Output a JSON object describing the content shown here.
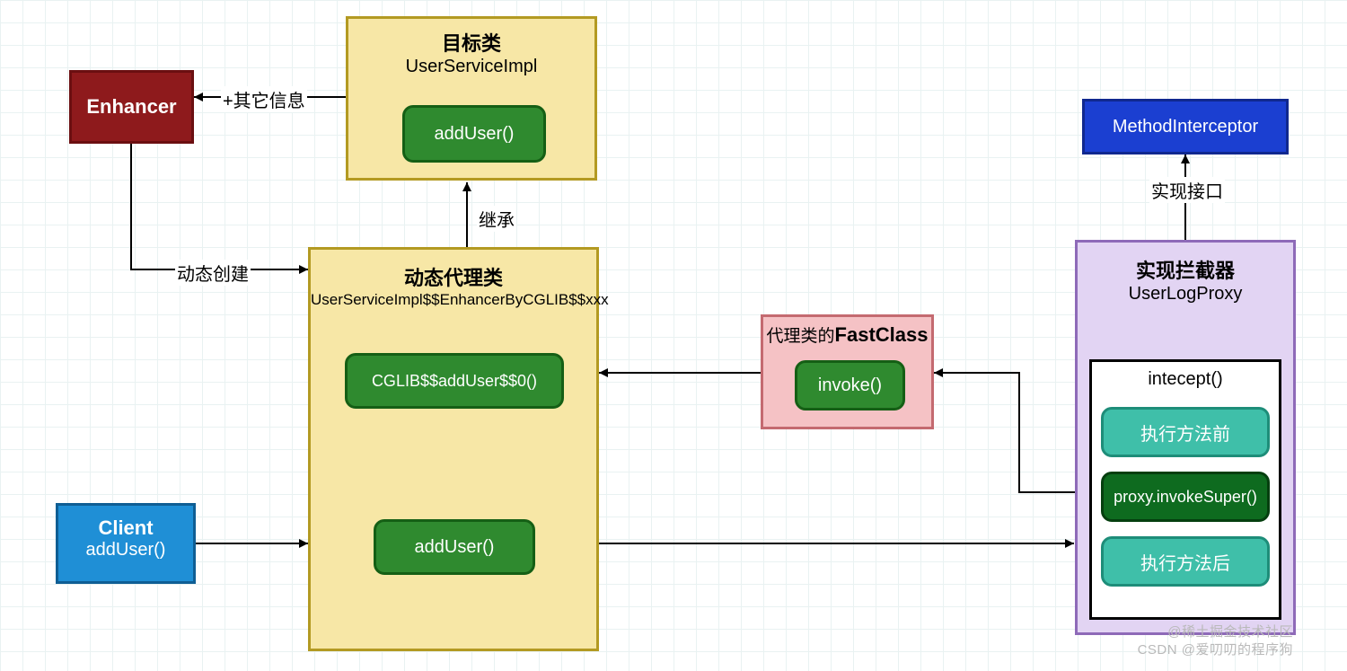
{
  "nodes": {
    "enhancer": {
      "label": "Enhancer"
    },
    "targetClass": {
      "title": "目标类",
      "subtitle": "UserServiceImpl",
      "method": "addUser()"
    },
    "methodInterceptor": {
      "label": "MethodInterceptor"
    },
    "proxyClass": {
      "title": "动态代理类",
      "subtitle": "UserServiceImpl$$EnhancerByCGLIB$$xxx",
      "method1": "CGLIB$$addUser$$0()",
      "method2": "addUser()"
    },
    "fastClass": {
      "title_prefix": "代理类的",
      "title_bold": "FastClass",
      "method": "invoke()"
    },
    "interceptorImpl": {
      "title": "实现拦截器",
      "subtitle": "UserLogProxy",
      "inner_title": "intecept()",
      "step_before": "执行方法前",
      "step_invoke": "proxy.invokeSuper()",
      "step_after": "执行方法后"
    },
    "client": {
      "title": "Client",
      "subtitle": "addUser()"
    }
  },
  "edges": {
    "otherInfo": "+其它信息",
    "dynamicCreate": "动态创建",
    "inherit": "继承",
    "implInterface": "实现接口"
  },
  "watermarks": {
    "w1": "@稀土掘金技术社区",
    "w2": "CSDN @爱叨叨的程序狗"
  },
  "colors": {
    "darkred": "#8e1a1c",
    "darkred_border": "#6b0f11",
    "yellow_fill": "#f7e7a6",
    "yellow_border": "#b39a22",
    "green_fill": "#2f8a2f",
    "green_border": "#155f15",
    "blue_fill": "#1f8fd6",
    "blue_border": "#0f5e94",
    "royal_fill": "#1b3fd1",
    "royal_border": "#10288f",
    "pink_fill": "#f5c2c5",
    "pink_border": "#c46a70",
    "purple_fill": "#e2d4f3",
    "purple_border": "#8e6ab8",
    "teal_fill": "#3fbfa9",
    "teal_border": "#1e8d79",
    "darkgreen_fill": "#0e6b1f",
    "darkgreen_border": "#053f0f"
  }
}
